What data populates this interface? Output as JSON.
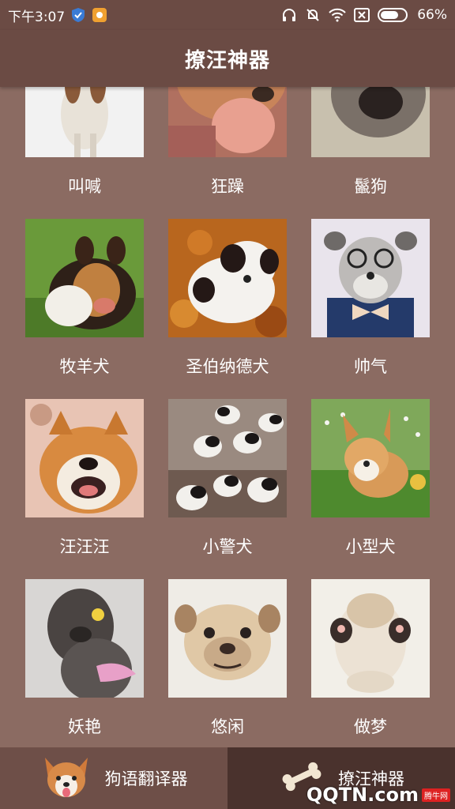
{
  "status_bar": {
    "time": "下午3:07",
    "battery": "66%"
  },
  "app_bar": {
    "title": "撩汪神器"
  },
  "grid": {
    "items": [
      {
        "label": "叫喊",
        "photo": "dog-photo-barking"
      },
      {
        "label": "狂躁",
        "photo": "dog-photo-manic"
      },
      {
        "label": "鬣狗",
        "photo": "dog-photo-hyena"
      },
      {
        "label": "牧羊犬",
        "photo": "dog-photo-collie"
      },
      {
        "label": "圣伯纳德犬",
        "photo": "dog-photo-saint-bernard"
      },
      {
        "label": "帅气",
        "photo": "dog-photo-schnauzer-glasses"
      },
      {
        "label": "汪汪汪",
        "photo": "dog-photo-shiba"
      },
      {
        "label": "小警犬",
        "photo": "dog-photo-puppies"
      },
      {
        "label": "小型犬",
        "photo": "dog-photo-corgi"
      },
      {
        "label": "妖艳",
        "photo": "dog-photo-poodle"
      },
      {
        "label": "悠闲",
        "photo": "dog-photo-pug-blanket"
      },
      {
        "label": "做梦",
        "photo": "dog-photo-sleeping-bulldog"
      }
    ]
  },
  "tabs": {
    "translator": "狗语翻译器",
    "flirt": "撩汪神器"
  },
  "watermark": {
    "text": "QQTN.com",
    "badge": "腾牛网"
  },
  "colors": {
    "background": "#8b6b62",
    "bar": "#6b4b44",
    "tab_active": "#4a322d"
  }
}
